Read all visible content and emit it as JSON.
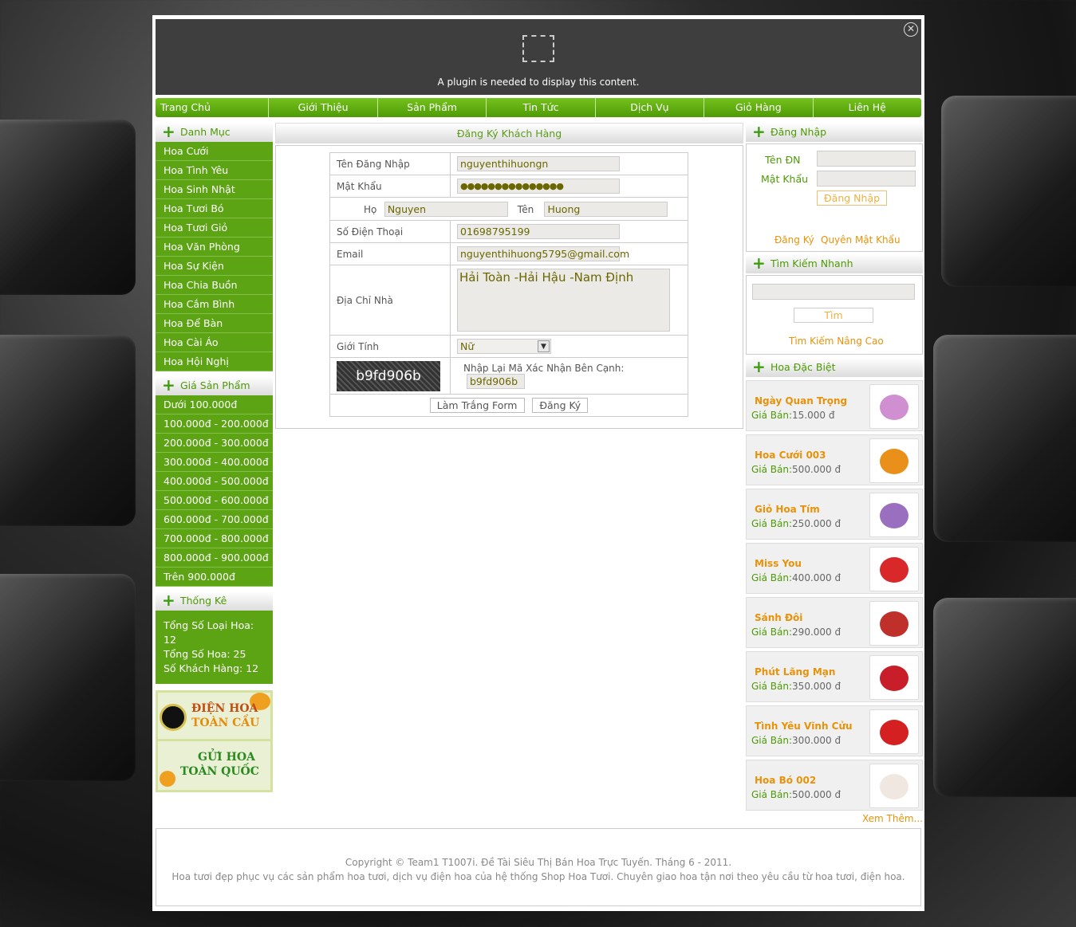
{
  "plugin": {
    "message": "A plugin is needed to display this content."
  },
  "nav": [
    "Trang Chủ",
    "Giới Thiệu",
    "Sản Phẩm",
    "Tin Tức",
    "Dịch Vụ",
    "Giỏ Hàng",
    "Liên Hệ"
  ],
  "left": {
    "category_title": "Danh Mục",
    "categories": [
      "Hoa Cưới",
      "Hoa Tình Yêu",
      "Hoa Sinh Nhật",
      "Hoa Tươi Bó",
      "Hoa Tươi Giỏ",
      "Hoa Văn Phòng",
      "Hoa Sự Kiện",
      "Hoa Chia Buồn",
      "Hoa Cắm Bình",
      "Hoa Để Bàn",
      "Hoa Cài Áo",
      "Hoa Hội Nghị"
    ],
    "price_title": "Giá Sản Phẩm",
    "prices": [
      "Dưới 100.000đ",
      "100.000đ - 200.000đ",
      "200.000đ - 300.000đ",
      "300.000đ - 400.000đ",
      "400.000đ - 500.000đ",
      "500.000đ - 600.000đ",
      "600.000đ - 700.000đ",
      "700.000đ - 800.000đ",
      "800.000đ - 900.000đ",
      "Trên 900.000đ"
    ],
    "stats_title": "Thống Kê",
    "stats": [
      "Tổng Số Loại Hoa: 12",
      "Tổng Số Hoa: 25",
      "Số Khách Hàng: 12"
    ],
    "banner1": {
      "line1": "ĐIỆN HOA",
      "line2": "TOÀN CẦU"
    },
    "banner2": {
      "line1": "GỬI HOA",
      "line2": "TOÀN QUỐC"
    }
  },
  "form": {
    "title": "Đăng Ký Khách Hàng",
    "username_label": "Tên Đăng Nhập",
    "username_value": "nguyenthihuongn",
    "password_label": "Mật Khẩu",
    "password_value": "●●●●●●●●●●●●●●●",
    "ho_label": "Họ",
    "ho_value": "Nguyen",
    "ten_label": "Tên",
    "ten_value": "Huong",
    "phone_label": "Số Điện Thoại",
    "phone_value": "01698795199",
    "email_label": "Email",
    "email_value": "nguyenthihuong5795@gmail.com",
    "address_label": "Địa Chỉ Nhà",
    "address_value": "Hải Toàn -Hải Hậu -Nam Định",
    "gender_label": "Giới Tính",
    "gender_value": "Nữ",
    "captcha_text": "b9fd906b",
    "captcha_label": "Nhập Lại Mã Xác Nhận Bên Cạnh:",
    "captcha_value": "b9fd906b",
    "reset_label": "Làm Trắng Form",
    "submit_label": "Đăng Ký"
  },
  "login": {
    "title": "Đăng Nhập",
    "user_label": "Tên ĐN",
    "pass_label": "Mật Khẩu",
    "button": "Đăng Nhập",
    "register": "Đăng Ký",
    "forgot": "Quyên Mật Khẩu"
  },
  "search": {
    "title": "Tìm Kiếm Nhanh",
    "button": "Tìm",
    "advanced": "Tìm Kiếm Nâng Cao"
  },
  "special": {
    "title": "Hoa Đặc Biệt",
    "price_prefix": "Giá Bán:",
    "items": [
      {
        "name": "Ngày Quan Trọng",
        "price": "15.000 đ",
        "color": "#d08fd0"
      },
      {
        "name": "Hoa Cưới 003",
        "price": "500.000 đ",
        "color": "#e8901a"
      },
      {
        "name": "Giỏ Hoa Tím",
        "price": "250.000 đ",
        "color": "#9b6fc0"
      },
      {
        "name": "Miss You",
        "price": "400.000 đ",
        "color": "#d8282a"
      },
      {
        "name": "Sánh Đôi",
        "price": "290.000 đ",
        "color": "#c0302a"
      },
      {
        "name": "Phút Lãng Mạn",
        "price": "350.000 đ",
        "color": "#c81e2a"
      },
      {
        "name": "Tình Yêu Vĩnh Cửu",
        "price": "300.000 đ",
        "color": "#d42020"
      },
      {
        "name": "Hoa Bó 002",
        "price": "500.000 đ",
        "color": "#f0e8e0"
      }
    ],
    "more": "Xem Thêm..."
  },
  "footer": {
    "line1": "Copyright © Team1 T1007i. Đề Tài Siêu Thị Bán Hoa Trực Tuyến. Tháng 6 - 2011.",
    "line2": "Hoa tươi đẹp phục vụ các sản phẩm hoa tươi, dịch vụ điện hoa của hệ thống Shop Hoa Tươi. Chuyên giao hoa tận nơi theo yêu cầu từ hoa tươi, điện hoa."
  }
}
